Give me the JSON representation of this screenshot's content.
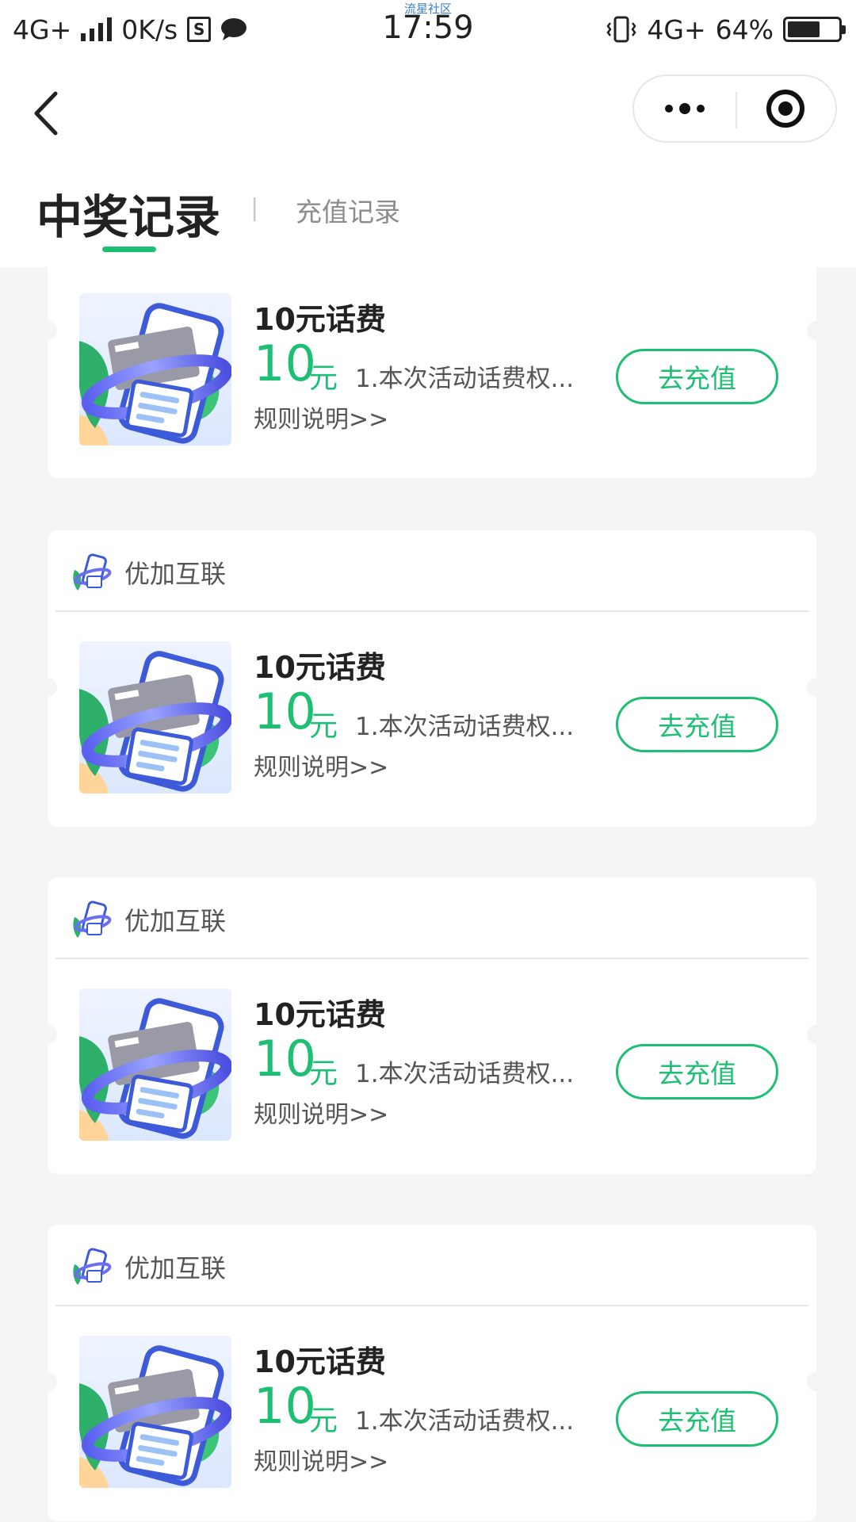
{
  "status_bar": {
    "network": "4G+",
    "speed": "0K/s",
    "s_box": "S",
    "community": "流星社区",
    "time": "17:59",
    "network_right": "4G+",
    "battery": "64%",
    "battery_level": 0.64,
    "icons": [
      "signal-icon",
      "s-box-icon",
      "chat-icon",
      "vibrate-icon",
      "battery-icon"
    ]
  },
  "nav": {
    "icons": [
      "back-arrow-icon",
      "more-dots-icon",
      "target-icon"
    ]
  },
  "tabs": {
    "active": "中奖记录",
    "separator": "|",
    "inactive": "充值记录"
  },
  "colors": {
    "accent": "#1dbf72",
    "background": "#f5f5f5",
    "card": "#ffffff"
  },
  "records": [
    {
      "brand": "",
      "title": "10元话费",
      "amount": "10",
      "unit": "元",
      "description": "1.本次活动话费权...",
      "rules": "规则说明>>",
      "button": "去充值"
    },
    {
      "brand": "优加互联",
      "title": "10元话费",
      "amount": "10",
      "unit": "元",
      "description": "1.本次活动话费权...",
      "rules": "规则说明>>",
      "button": "去充值"
    },
    {
      "brand": "优加互联",
      "title": "10元话费",
      "amount": "10",
      "unit": "元",
      "description": "1.本次活动话费权...",
      "rules": "规则说明>>",
      "button": "去充值"
    },
    {
      "brand": "优加互联",
      "title": "10元话费",
      "amount": "10",
      "unit": "元",
      "description": "1.本次活动话费权...",
      "rules": "规则说明>>",
      "button": "去充值"
    }
  ]
}
